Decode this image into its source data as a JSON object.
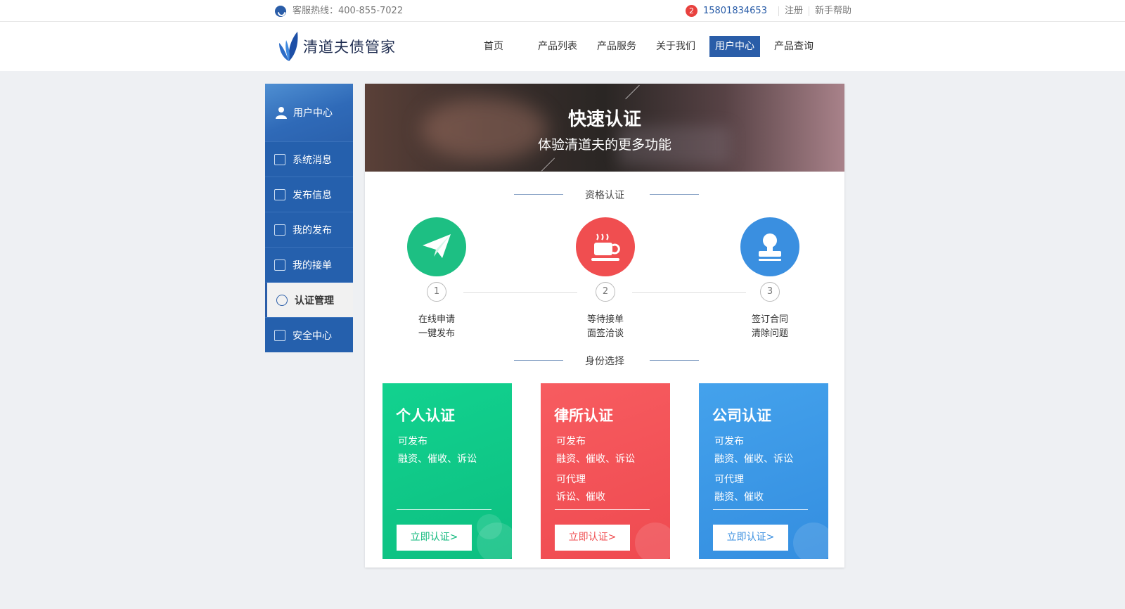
{
  "topbar": {
    "hotline": "客服热线：400-855-7022",
    "notification_count": "2",
    "phone": "15801834653",
    "register": "注册",
    "help": "新手帮助"
  },
  "header": {
    "logo_text": "清道夫债管家",
    "nav": [
      "首页",
      "产品列表",
      "产品服务",
      "关于我们",
      "用户中心",
      "产品查询"
    ],
    "active_nav": "用户中心"
  },
  "sidebar": {
    "title": "用户中心",
    "items": [
      {
        "label": "系统消息",
        "icon": "mail-icon"
      },
      {
        "label": "发布信息",
        "icon": "edit-icon"
      },
      {
        "label": "我的发布",
        "icon": "publish-icon"
      },
      {
        "label": "我的接单",
        "icon": "list-icon"
      },
      {
        "label": "认证管理",
        "icon": "verified-icon",
        "active": true
      },
      {
        "label": "安全中心",
        "icon": "shield-icon"
      }
    ]
  },
  "banner": {
    "title": "快速认证",
    "subtitle": "体验清道夫的更多功能"
  },
  "qualification": {
    "title": "资格认证",
    "steps": [
      {
        "num": "1",
        "line1": "在线申请",
        "line2": "一键发布",
        "color": "#1dbf83",
        "icon": "paper-plane-icon"
      },
      {
        "num": "2",
        "line1": "等待接单",
        "line2": "面签洽谈",
        "color": "#f04e50",
        "icon": "coffee-cup-icon"
      },
      {
        "num": "3",
        "line1": "签订合同",
        "line2": "清除问题",
        "color": "#3a8fe0",
        "icon": "stamp-icon"
      }
    ]
  },
  "identity": {
    "title": "身份选择",
    "cards": [
      {
        "title": "个人认证",
        "lines": [
          "可发布",
          "融资、催收、诉讼"
        ],
        "button": "立即认证>",
        "color": "#10c98a",
        "btn_color": "#10b97d"
      },
      {
        "title": "律所认证",
        "lines": [
          "可发布",
          "融资、催收、诉讼",
          "可代理",
          "诉讼、催收"
        ],
        "button": "立即认证>",
        "color": "#f5545a",
        "btn_color": "#f04e50"
      },
      {
        "title": "公司认证",
        "lines": [
          "可发布",
          "融资、催收、诉讼",
          "可代理",
          "融资、催收"
        ],
        "button": "立即认证>",
        "color": "#3a9ae8",
        "btn_color": "#3a8fe0"
      }
    ]
  }
}
